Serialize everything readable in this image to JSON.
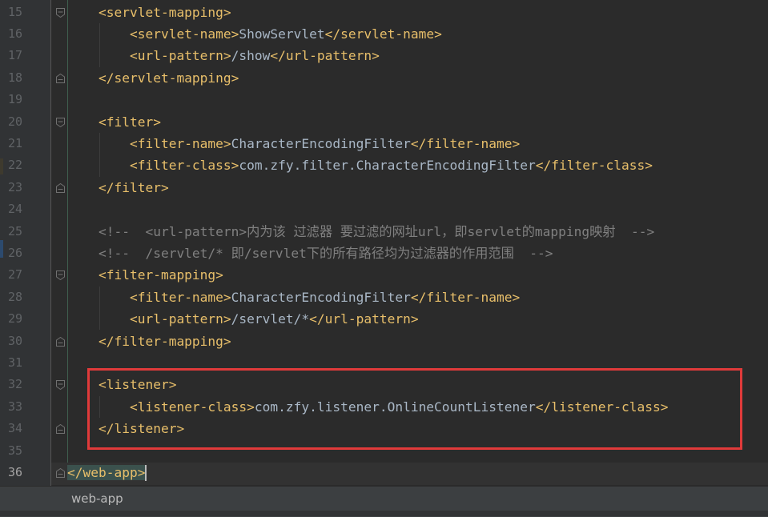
{
  "editor": {
    "line_numbers": [
      "15",
      "16",
      "17",
      "18",
      "19",
      "20",
      "21",
      "22",
      "23",
      "24",
      "25",
      "26",
      "27",
      "28",
      "29",
      "30",
      "31",
      "32",
      "33",
      "34",
      "35",
      "36"
    ],
    "current_line": "36",
    "lines": [
      {
        "n": "15",
        "ws": "    ",
        "tokens": [
          [
            "t",
            "<servlet-mapping>"
          ]
        ]
      },
      {
        "n": "16",
        "ws": "        ",
        "tokens": [
          [
            "t",
            "<servlet-name>"
          ],
          [
            "x",
            "ShowServlet"
          ],
          [
            "t",
            "</servlet-name>"
          ]
        ]
      },
      {
        "n": "17",
        "ws": "        ",
        "tokens": [
          [
            "t",
            "<url-pattern>"
          ],
          [
            "x",
            "/show"
          ],
          [
            "t",
            "</url-pattern>"
          ]
        ]
      },
      {
        "n": "18",
        "ws": "    ",
        "tokens": [
          [
            "t",
            "</servlet-mapping>"
          ]
        ]
      },
      {
        "n": "19",
        "ws": "",
        "tokens": []
      },
      {
        "n": "20",
        "ws": "    ",
        "tokens": [
          [
            "t",
            "<filter>"
          ]
        ]
      },
      {
        "n": "21",
        "ws": "        ",
        "tokens": [
          [
            "t",
            "<filter-name>"
          ],
          [
            "x",
            "CharacterEncodingFilter"
          ],
          [
            "t",
            "</filter-name>"
          ]
        ]
      },
      {
        "n": "22",
        "ws": "        ",
        "tokens": [
          [
            "t",
            "<filter-class>"
          ],
          [
            "x",
            "com.zfy.filter.CharacterEncodingFilter"
          ],
          [
            "t",
            "</filter-class>"
          ]
        ]
      },
      {
        "n": "23",
        "ws": "    ",
        "tokens": [
          [
            "t",
            "</filter>"
          ]
        ]
      },
      {
        "n": "24",
        "ws": "",
        "tokens": []
      },
      {
        "n": "25",
        "ws": "    ",
        "tokens": [
          [
            "c",
            "<!--  <url-pattern>内为该 过滤器 要过滤的网址url，即servlet的mapping映射  -->"
          ]
        ]
      },
      {
        "n": "26",
        "ws": "    ",
        "tokens": [
          [
            "c",
            "<!--  /servlet/* 即/servlet下的所有路径均为过滤器的作用范围  -->"
          ]
        ]
      },
      {
        "n": "27",
        "ws": "    ",
        "tokens": [
          [
            "t",
            "<filter-mapping>"
          ]
        ]
      },
      {
        "n": "28",
        "ws": "        ",
        "tokens": [
          [
            "t",
            "<filter-name>"
          ],
          [
            "x",
            "CharacterEncodingFilter"
          ],
          [
            "t",
            "</filter-name>"
          ]
        ]
      },
      {
        "n": "29",
        "ws": "        ",
        "tokens": [
          [
            "t",
            "<url-pattern>"
          ],
          [
            "x",
            "/servlet/*"
          ],
          [
            "t",
            "</url-pattern>"
          ]
        ]
      },
      {
        "n": "30",
        "ws": "    ",
        "tokens": [
          [
            "t",
            "</filter-mapping>"
          ]
        ]
      },
      {
        "n": "31",
        "ws": "",
        "tokens": []
      },
      {
        "n": "32",
        "ws": "    ",
        "tokens": [
          [
            "t",
            "<listener>"
          ]
        ]
      },
      {
        "n": "33",
        "ws": "        ",
        "tokens": [
          [
            "t",
            "<listener-class>"
          ],
          [
            "x",
            "com.zfy.listener.OnlineCountListener"
          ],
          [
            "t",
            "</listener-class>"
          ]
        ]
      },
      {
        "n": "34",
        "ws": "    ",
        "tokens": [
          [
            "t",
            "</listener>"
          ]
        ]
      },
      {
        "n": "35",
        "ws": "",
        "tokens": []
      },
      {
        "n": "36",
        "ws": "",
        "tokens": [
          [
            "hl",
            "</web-app>"
          ]
        ]
      }
    ]
  },
  "breadcrumb": {
    "label": "web-app"
  },
  "colors": {
    "background": "#2b2b2b",
    "gutter": "#313335",
    "tag": "#e8bf6a",
    "text": "#a9b7c6",
    "comment": "#808080",
    "annotation_box": "#e03a3a"
  }
}
